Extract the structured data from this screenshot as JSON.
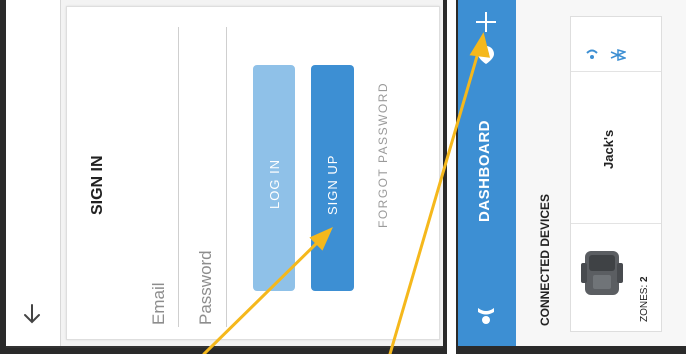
{
  "left_screen": {
    "title": "SIGN IN",
    "email_placeholder": "Email",
    "password_placeholder": "Password",
    "login_label": "LOG IN",
    "signup_label": "SIGN UP",
    "forgot_label": "FORGOT PASSWORD",
    "back_icon": "arrow-down-icon"
  },
  "right_screen": {
    "nav_title": "DASHBOARD",
    "add_icon": "plus-icon",
    "location_icon": "pin-icon",
    "profile_icon": "person-icon",
    "section_title": "CONNECTED DEVICES",
    "device": {
      "name": "Jack's",
      "zones_label": "ZONES:",
      "zones_value": "2",
      "status_icons": [
        "wifi-icon",
        "bluetooth-icon"
      ]
    }
  },
  "colors": {
    "primary": "#3d8fd3",
    "login_button": "#8fc1e8",
    "annotation_arrow": "#f5b81c"
  }
}
